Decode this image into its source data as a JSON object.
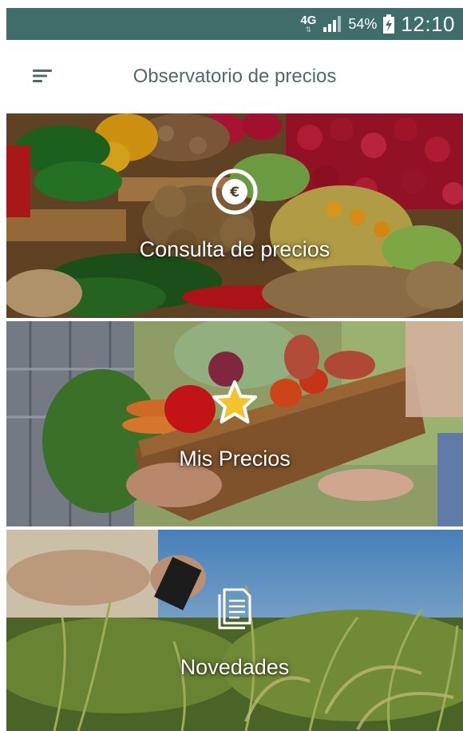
{
  "status_bar": {
    "network": "4G",
    "battery_percent": "54%",
    "time": "12:10"
  },
  "app_bar": {
    "title": "Observatorio de precios"
  },
  "cards": [
    {
      "label": "Consulta de precios",
      "icon": "euro-coin-icon"
    },
    {
      "label": "Mis Precios",
      "icon": "star-icon"
    },
    {
      "label": "Novedades",
      "icon": "document-icon"
    }
  ],
  "colors": {
    "status_bar": "#3f6e6a",
    "title_text": "#4f6b68",
    "card_text": "#ffffff"
  }
}
